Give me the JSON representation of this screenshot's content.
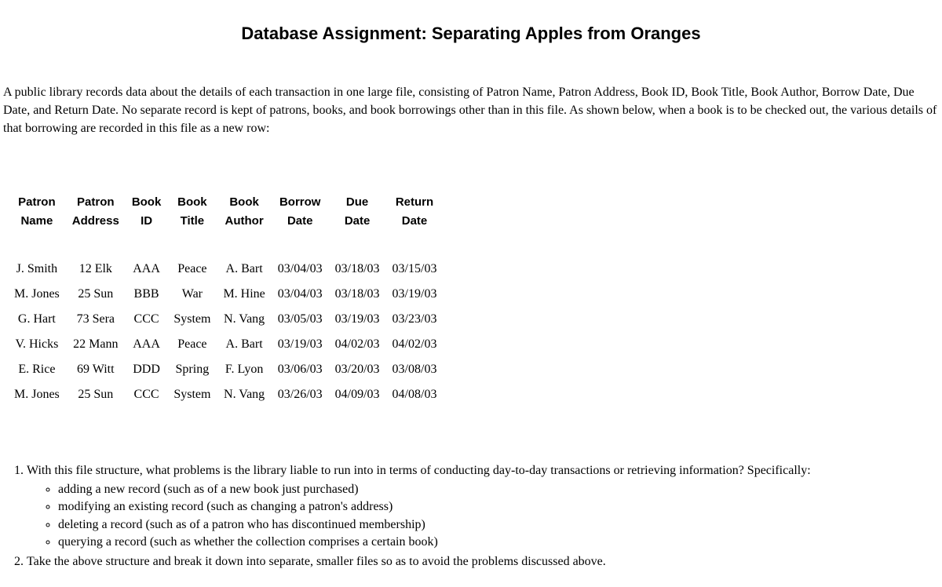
{
  "title": "Database Assignment: Separating Apples from Oranges",
  "intro": "A public library records data about the details of each transaction in one large file, consisting of Patron Name, Patron Address, Book ID, Book Title, Book Author, Borrow Date, Due Date, and Return Date. No separate record is kept of patrons, books, and book borrowings other than in this file. As shown below, when a book is to be checked out, the various details of that borrowing are recorded in this file as a new row:",
  "table": {
    "headers": {
      "patron_name": "Patron\nName",
      "patron_address": "Patron\nAddress",
      "book_id": "Book\nID",
      "book_title": "Book\nTitle",
      "book_author": "Book\nAuthor",
      "borrow_date": "Borrow\nDate",
      "due_date": "Due\nDate",
      "return_date": "Return\nDate"
    },
    "rows": [
      {
        "patron_name": "J. Smith",
        "patron_address": "12 Elk",
        "book_id": "AAA",
        "book_title": "Peace",
        "book_author": "A. Bart",
        "borrow_date": "03/04/03",
        "due_date": "03/18/03",
        "return_date": "03/15/03"
      },
      {
        "patron_name": "M. Jones",
        "patron_address": "25 Sun",
        "book_id": "BBB",
        "book_title": "War",
        "book_author": "M. Hine",
        "borrow_date": "03/04/03",
        "due_date": "03/18/03",
        "return_date": "03/19/03"
      },
      {
        "patron_name": "G. Hart",
        "patron_address": "73 Sera",
        "book_id": "CCC",
        "book_title": "System",
        "book_author": "N. Vang",
        "borrow_date": "03/05/03",
        "due_date": "03/19/03",
        "return_date": "03/23/03"
      },
      {
        "patron_name": "V. Hicks",
        "patron_address": "22 Mann",
        "book_id": "AAA",
        "book_title": "Peace",
        "book_author": "A. Bart",
        "borrow_date": "03/19/03",
        "due_date": "04/02/03",
        "return_date": "04/02/03"
      },
      {
        "patron_name": "E. Rice",
        "patron_address": "69 Witt",
        "book_id": "DDD",
        "book_title": "Spring",
        "book_author": "F. Lyon",
        "borrow_date": "03/06/03",
        "due_date": "03/20/03",
        "return_date": "03/08/03"
      },
      {
        "patron_name": "M. Jones",
        "patron_address": "25 Sun",
        "book_id": "CCC",
        "book_title": "System",
        "book_author": "N. Vang",
        "borrow_date": "03/26/03",
        "due_date": "04/09/03",
        "return_date": "04/08/03"
      }
    ]
  },
  "questions": {
    "q1": "With this file structure, what problems is the library liable to run into in terms of conducting day-to-day transactions or retrieving information? Specifically:",
    "q1_sub": [
      "adding a new record (such as of a new book just purchased)",
      "modifying an existing record (such as changing a patron's address)",
      "deleting a record (such as of a patron who has discontinued membership)",
      "querying a record (such as whether the collection comprises a certain book)"
    ],
    "q2": "Take the above structure and break it down into separate, smaller files so as to avoid the problems discussed above."
  }
}
